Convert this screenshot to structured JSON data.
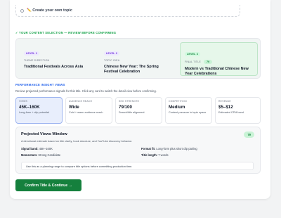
{
  "own_topic": {
    "label": "✏️ Create your own topic"
  },
  "selection": {
    "header": "✓ YOUR CONTENT SELECTION — REVIEW BEFORE CONFIRMING",
    "items": [
      {
        "level": "LEVEL 1",
        "caption": "THEME DIRECTION",
        "value": "Traditional Festivals Across Asia"
      },
      {
        "level": "LEVEL 2",
        "caption": "TOPIC IDEA",
        "value": "Chinese New Year: The Spring Festival Celebration"
      },
      {
        "level": "LEVEL 3",
        "caption": "FINAL TITLE",
        "score": "79",
        "value": "Modern vs Traditional Chinese New Year Celebrations"
      }
    ]
  },
  "insights": {
    "header": "PERFORMANCE INSIGHT VIEWS",
    "subtitle": "Review projected performance signals for this title. Click any card to switch the detail view before confirming.",
    "metrics": [
      {
        "label": "VIEWS",
        "value": "45K–160K",
        "sub": "Long-form + clip potential"
      },
      {
        "label": "AUDIENCE REACH",
        "value": "Wide",
        "sub": "Cold + warm audience reach"
      },
      {
        "label": "SEO STRENGTH",
        "value": "79/100",
        "sub": "Search/title alignment"
      },
      {
        "label": "COMPETITION",
        "value": "Medium",
        "sub": "Content pressure in topic space"
      },
      {
        "label": "REVENUE",
        "value": "$5–$12",
        "sub": "Estimated CPM band"
      }
    ]
  },
  "detail": {
    "title": "Projected Views Window",
    "score": "79",
    "description": "A directional estimate based on title clarity, hook structure, and YouTube discovery behavior.",
    "signal_band_label": "Signal band:",
    "signal_band_value": "45K–160K",
    "format_fit_label": "Format fit:",
    "format_fit_value": "Long-form plus short clip pairing",
    "momentum_label": "Momentum:",
    "momentum_value": "Strong Candidate",
    "title_length_label": "Title length:",
    "title_length_value": "7 words",
    "note": "Use this as a planning range to compare title options before committing production time."
  },
  "confirm_button": "Confirm Title & Continue →",
  "colors": {
    "accent_green": "#15803d",
    "accent_blue": "#2563eb",
    "active_card": "#e8eefc"
  }
}
